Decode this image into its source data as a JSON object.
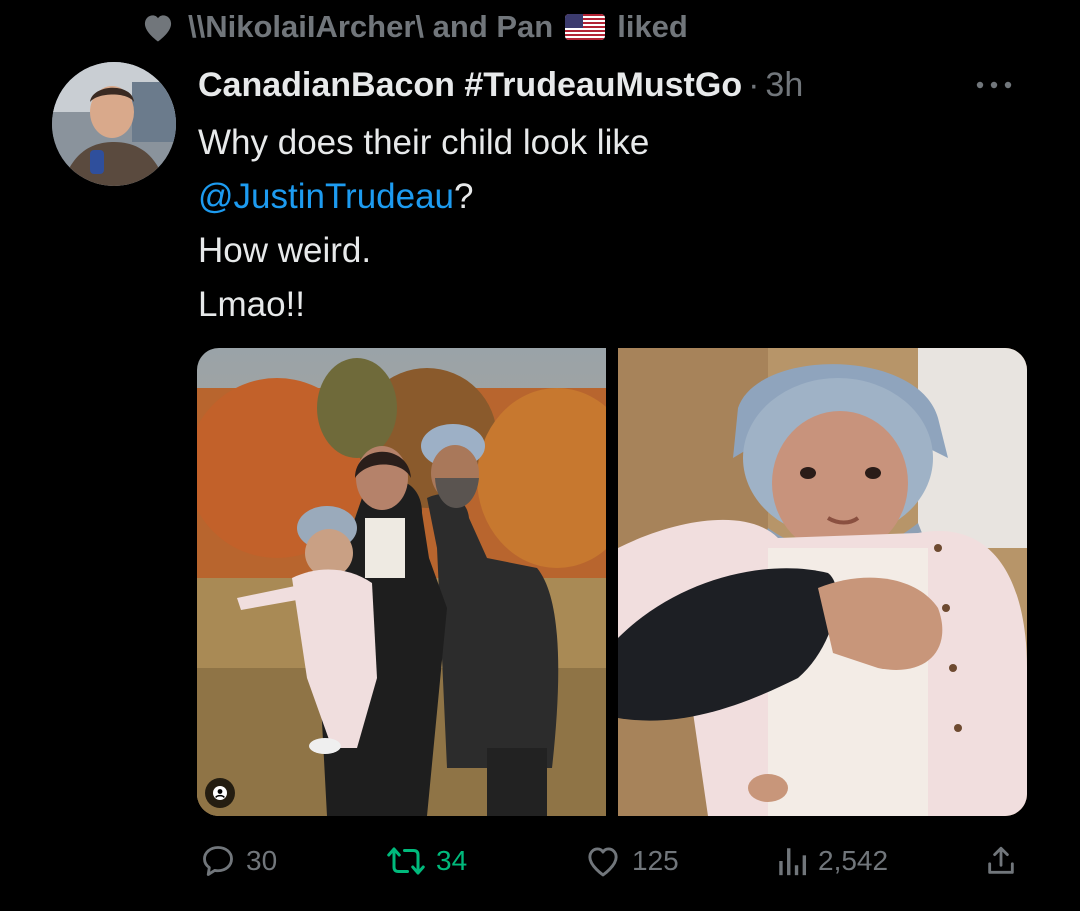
{
  "social_context": {
    "text": "\\\\NikolaiIArcher\\ and Pan",
    "suffix": "liked"
  },
  "tweet": {
    "display_name": "CanadianBacon #TrudeauMustGo",
    "separator": "·",
    "time": "3h",
    "text_line1": "Why does their child look like",
    "mention": "@JustinTrudeau",
    "mention_suffix": "?",
    "text_line3": "How weird.",
    "text_line4": "Lmao!!"
  },
  "actions": {
    "replies": "30",
    "retweets": "34",
    "likes": "125",
    "views": "2,542"
  },
  "colors": {
    "background": "#000000",
    "text": "#e7e9ea",
    "muted": "#71767b",
    "link": "#1d9bf0",
    "retweet": "#00ba7c"
  },
  "icons": [
    "heart-icon",
    "us-flag-icon",
    "more-icon",
    "reply-icon",
    "retweet-icon",
    "like-icon",
    "views-icon",
    "share-icon",
    "alt-person-icon"
  ]
}
